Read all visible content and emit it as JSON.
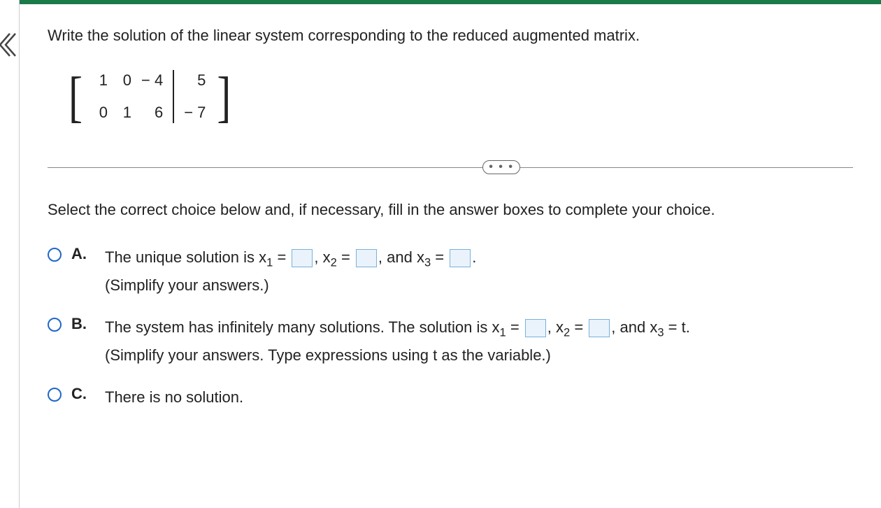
{
  "question": "Write the solution of the linear system corresponding to the reduced augmented matrix.",
  "matrix": {
    "row1_left": [
      "1",
      "0",
      "− 4"
    ],
    "row1_right": "5",
    "row2_left": [
      "0",
      "1",
      "6"
    ],
    "row2_right": "− 7"
  },
  "instruction": "Select the correct choice below and, if necessary, fill in the answer boxes to complete your choice.",
  "choices": {
    "A": {
      "label": "A.",
      "text_pre": "The unique solution is x",
      "mid1": ", x",
      "mid2": ", and x",
      "eq": " = ",
      "end": ".",
      "hint": "(Simplify your answers.)"
    },
    "B": {
      "label": "B.",
      "text_pre": "The system has infinitely many solutions. The solution is x",
      "mid1": ", x",
      "mid2": ", and x",
      "eq": " = ",
      "x3_tail": " = t.",
      "hint": "(Simplify your answers. Type expressions using t as the variable.)"
    },
    "C": {
      "label": "C.",
      "text": "There is no solution."
    }
  },
  "subs": {
    "s1": "1",
    "s2": "2",
    "s3": "3"
  },
  "dots": "• • •"
}
